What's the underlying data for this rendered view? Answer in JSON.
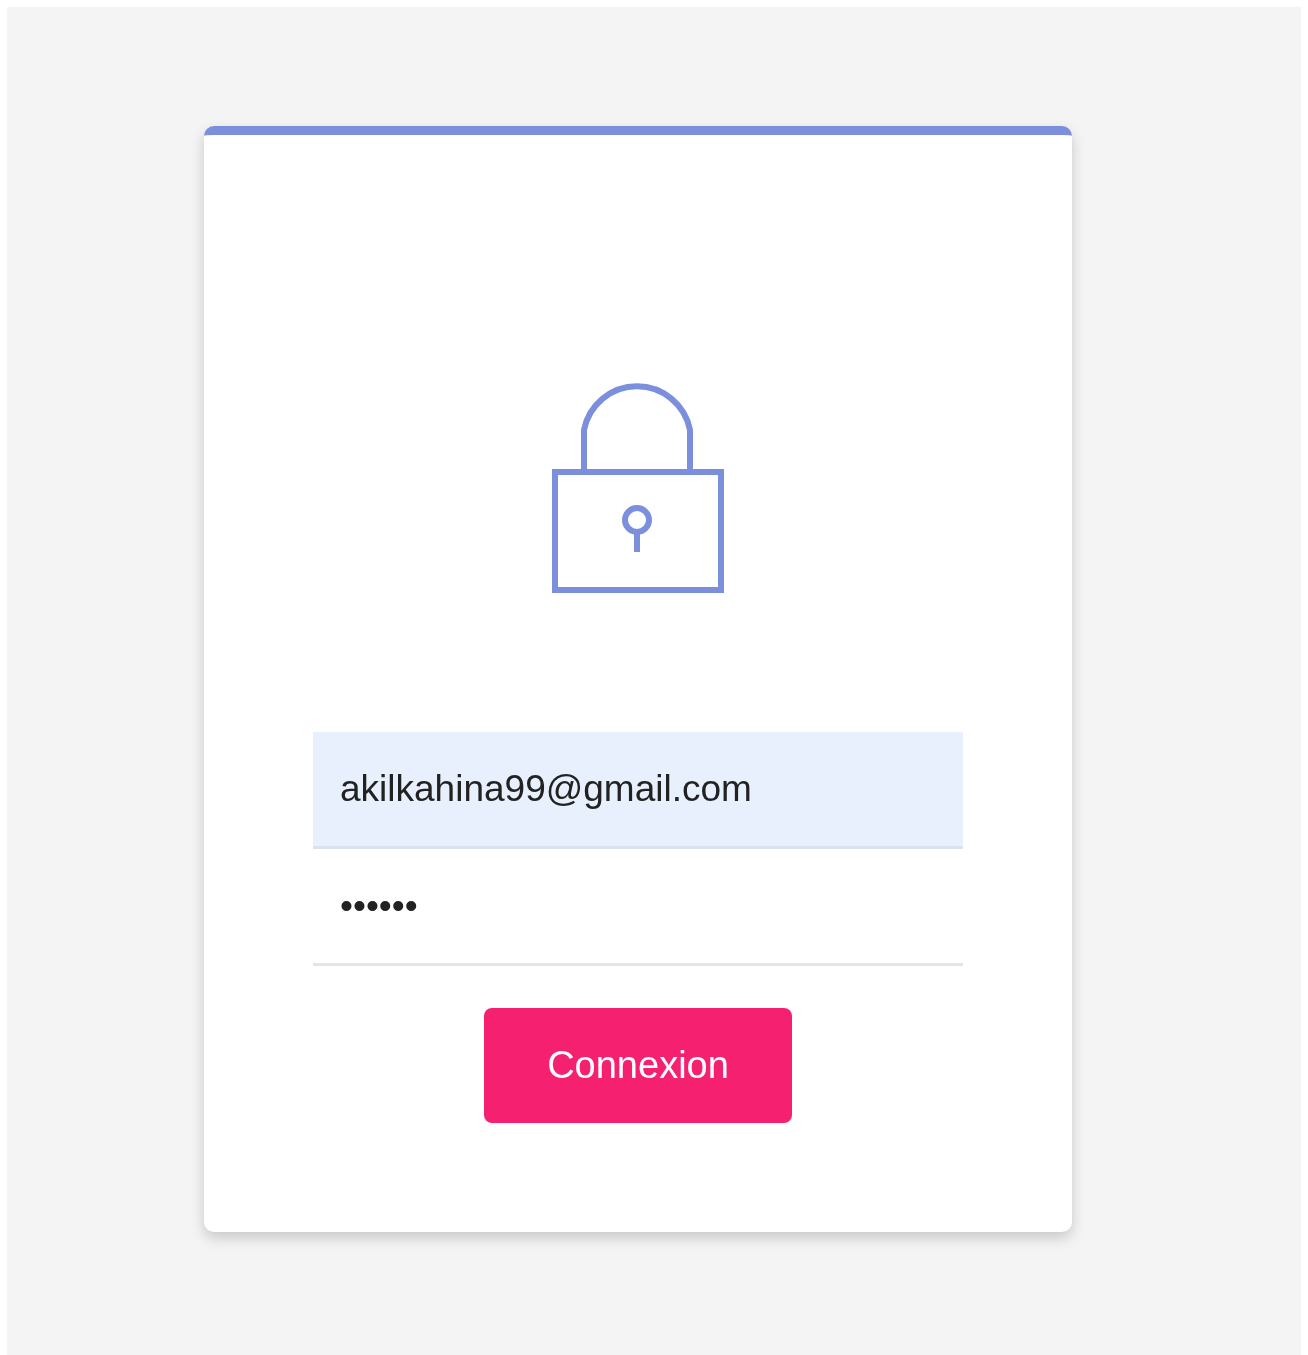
{
  "login_form": {
    "email": {
      "value": "akilkahina99@gmail.com",
      "autofilled": true
    },
    "password": {
      "value": "••••••"
    },
    "submit_button": {
      "label": "Connexion"
    }
  }
}
